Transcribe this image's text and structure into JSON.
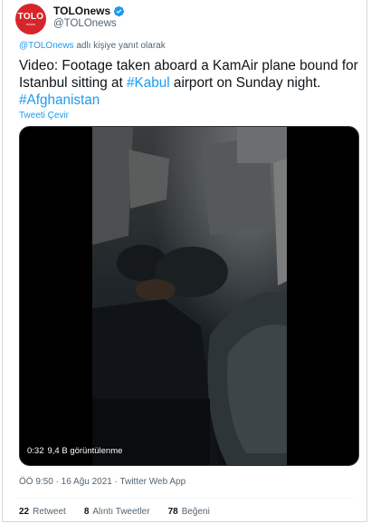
{
  "author": {
    "avatar_top": "TOLO",
    "avatar_bottom": "news",
    "display_name": "TOLOnews",
    "handle": "@TOLOnews"
  },
  "reply": {
    "mention": "@TOLOnews",
    "suffix": " adlı kişiye yanıt olarak"
  },
  "tweet": {
    "text_part1": "Video: Footage taken aboard a KamAir plane bound for Istanbul sitting at ",
    "hashtag1": "#Kabul",
    "text_part2": " airport on Sunday night. ",
    "hashtag2": "#Afghanistan",
    "translate_label": "Tweeti Çevir"
  },
  "video": {
    "duration": "0:32",
    "views": "9,4 B görüntülenme"
  },
  "meta": {
    "time_date_source": "ÖÖ 9:50 · 16 Ağu 2021 · Twitter Web App"
  },
  "stats": {
    "retweets_count": "22",
    "retweets_label": "Retweet",
    "quotes_count": "8",
    "quotes_label": "Alıntı Tweetler",
    "likes_count": "78",
    "likes_label": "Beğeni"
  },
  "colors": {
    "accent": "#1d9bf0",
    "brand_red": "#d6262b"
  }
}
